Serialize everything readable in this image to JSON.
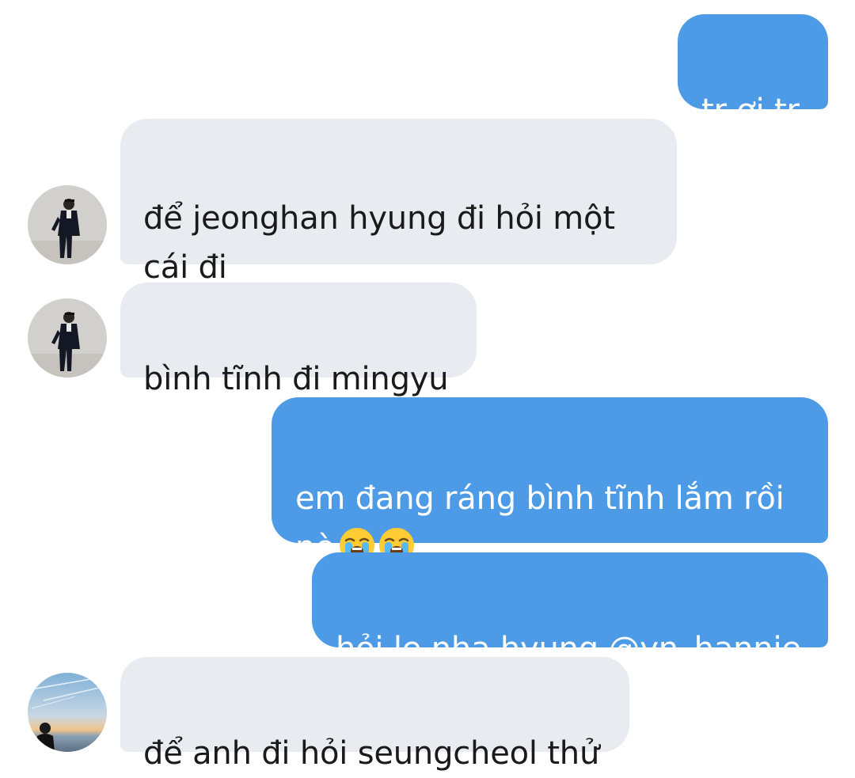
{
  "messages": [
    {
      "side": "sent",
      "text": "tr ơi tr"
    },
    {
      "side": "received",
      "text": "để jeonghan hyung đi hỏi một\ncái đi"
    },
    {
      "side": "received",
      "text": "bình tĩnh đi mingyu"
    },
    {
      "side": "sent",
      "text": "em đang ráng bình tĩnh lắm rồi\nnè",
      "emoji": [
        "loudly-crying-face-icon",
        "loudly-crying-face-icon"
      ]
    },
    {
      "side": "sent",
      "text": "hỏi lẹ nha hyung @yn_hannie"
    },
    {
      "side": "received",
      "text": "để anh đi hỏi seungcheol thử"
    }
  ],
  "colors": {
    "sent_bubble": "#4d9be6",
    "received_bubble": "#e8ecf0",
    "sent_text": "#ffffff",
    "received_text": "#1a1a1a"
  }
}
